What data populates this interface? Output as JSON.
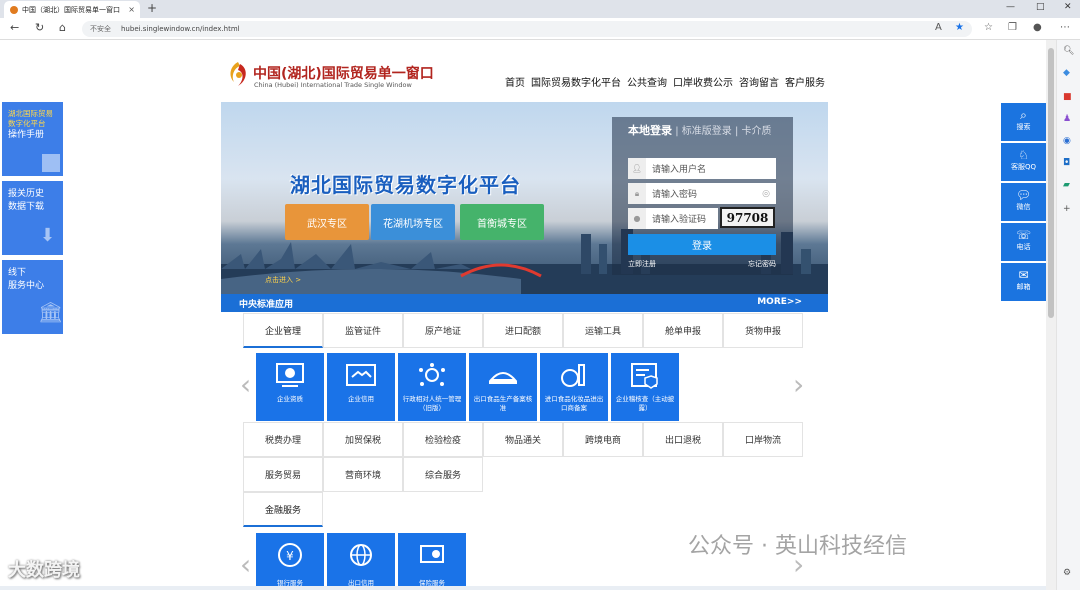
{
  "browser": {
    "tab_title": "中国（湖北）国际贸易单一窗口",
    "tab_close": "×",
    "new_tab": "+",
    "security": "不安全",
    "url": "hubei.singlewindow.cn/index.html"
  },
  "header": {
    "logo_title": "中国(湖北)国际贸易单一窗口",
    "logo_subtitle": "China (Hubei) International Trade Single Window",
    "nav": [
      "首页",
      "国际贸易数字化平台",
      "公共查询",
      "口岸收费公示",
      "咨询留言",
      "客户服务"
    ]
  },
  "banner": {
    "title": "湖北国际贸易数字化平台",
    "zones": [
      "武汉专区",
      "花湖机场专区",
      "首衡城专区"
    ],
    "enter": "点击进入 >"
  },
  "login": {
    "tab_active": "本地登录",
    "tab_sep": "|",
    "tab_standard": "标准版登录",
    "tab_card": "卡介质",
    "username_placeholder": "请输入用户名",
    "password_placeholder": "请输入密码",
    "captcha_placeholder": "请输入验证码",
    "captcha_code": "97708",
    "submit": "登录",
    "register": "立即注册",
    "forgot": "忘记密码"
  },
  "section": {
    "title": "中央标准应用",
    "more": "MORE>>"
  },
  "categories_row1": [
    "企业管理",
    "监管证件",
    "原产地证",
    "进口配额",
    "运输工具",
    "舱单申报",
    "货物申报"
  ],
  "tiles_row1": [
    "企业资质",
    "企业信用",
    "行政相对人统一管理（旧版）",
    "出口食品生产备案核准",
    "进口食品化妆品进出口商备案",
    "企业稽核查（主动披露）"
  ],
  "categories_row2": [
    "税费办理",
    "加贸保税",
    "检验检疫",
    "物品通关",
    "跨境电商",
    "出口退税",
    "口岸物流"
  ],
  "categories_row3": [
    "服务贸易",
    "营商环境",
    "综合服务"
  ],
  "categories_row4": [
    "金融服务"
  ],
  "tiles_row2": [
    "银行服务",
    "出口信用",
    "保险服务"
  ],
  "left_float": [
    {
      "line1": "湖北国际贸易",
      "line2": "数字化平台",
      "line3": "操作手册"
    },
    {
      "line1": "报关历史",
      "line2": "数据下载"
    },
    {
      "line1": "线下",
      "line2": "服务中心"
    }
  ],
  "right_float": [
    "搜索",
    "客服QQ",
    "微信",
    "电话",
    "邮箱"
  ],
  "watermark_left": "大数跨境",
  "watermark_right": "公众号 · 英山科技经信",
  "colors": {
    "brand_red": "#b2251f",
    "primary_blue": "#1a73e8",
    "section_blue": "#1b6fd6",
    "zone_orange": "#e8953a",
    "zone_blue": "#3b8fd9",
    "zone_green": "#45b36b"
  }
}
